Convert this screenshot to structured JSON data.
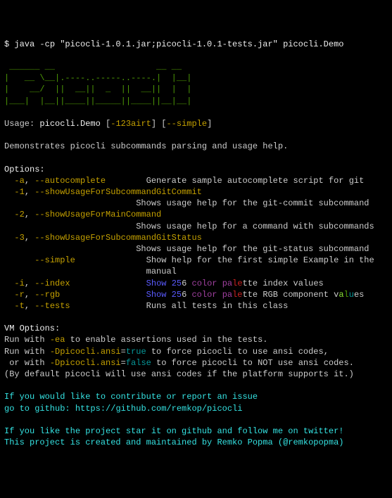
{
  "prompt": "$ ",
  "command": "java -cp \"picocli-1.0.1.jar;picocli-1.0.1-tests.jar\" picocli.Demo",
  "ascii_art": " ______ __                    __ __\n|   __ \\__|.----..-----..----.|  |__|\n|    __/  ||  __||  _  ||  __||  |  |\n|___|  |__||____||_____||____||__|__|",
  "usage_prefix": "Usage: ",
  "usage_cmd": "picocli.Demo",
  "usage_brk1": " [",
  "usage_shortopts": "-123airt",
  "usage_brk2": "] [",
  "usage_longopt": "--simple",
  "usage_brk3": "]",
  "description": "Demonstrates picocli subcommands parsing and usage help.",
  "options_header": "Options:",
  "opts": [
    {
      "pad": "  ",
      "short": "-a",
      "sep": ", ",
      "long": "--autocomplete",
      "gap": "        ",
      "desc": "Generate sample autocomplete script for git"
    },
    {
      "pad": "  ",
      "short": "-1",
      "sep": ", ",
      "long": "--showUsageForSubcommandGitCommit",
      "gap": "",
      "desc": ""
    },
    {
      "pad": "                          ",
      "short": "",
      "sep": "",
      "long": "",
      "gap": "",
      "desc": "Shows usage help for the git-commit subcommand"
    },
    {
      "pad": "  ",
      "short": "-2",
      "sep": ", ",
      "long": "--showUsageForMainCommand",
      "gap": "",
      "desc": ""
    },
    {
      "pad": "                          ",
      "short": "",
      "sep": "",
      "long": "",
      "gap": "",
      "desc": "Shows usage help for a command with subcommands"
    },
    {
      "pad": "  ",
      "short": "-3",
      "sep": ", ",
      "long": "--showUsageForSubcommandGitStatus",
      "gap": "",
      "desc": ""
    },
    {
      "pad": "                          ",
      "short": "",
      "sep": "",
      "long": "",
      "gap": "",
      "desc": "Shows usage help for the git-status subcommand"
    },
    {
      "pad": "      ",
      "short": "",
      "sep": "",
      "long": "--simple",
      "gap": "              ",
      "desc": "Show help for the first simple Example in the"
    },
    {
      "pad": "                            ",
      "short": "",
      "sep": "",
      "long": "",
      "gap": "",
      "desc": "manual"
    }
  ],
  "color_opts": {
    "i": {
      "short": "-i",
      "long": "--index",
      "w1": "Show",
      "w2": "25",
      "w3": "6",
      "w4": "color",
      "w5": "pa",
      "w6": "le",
      "w7": "tte",
      "tail": " index values"
    },
    "r": {
      "short": "-r",
      "long": "--rgb",
      "w1": "Show",
      "w2": "25",
      "w3": "6",
      "w4": "color",
      "w5": "pa",
      "w6": "le",
      "w7": "tte",
      "tail1": " RGB component v",
      "tail2": "a",
      "tail3": "l",
      "tail4": "u",
      "tail5": "es"
    },
    "t": {
      "short": "-t",
      "long": "--tests",
      "desc": "Runs all tests in this class"
    }
  },
  "vm_header": "VM Options:",
  "vm_l1_a": "Run with ",
  "vm_l1_b": "-ea",
  "vm_l1_c": " to enable assertions used in the tests.",
  "vm_l2_a": "Run with ",
  "vm_l2_b": "-Dpicocli.ansi",
  "vm_l2_c": "=",
  "vm_l2_d": "true",
  "vm_l2_e": " to force picocli to use ansi codes,",
  "vm_l3_a": " or with ",
  "vm_l3_b": "-Dpicocli.ansi",
  "vm_l3_c": "=",
  "vm_l3_d": "false",
  "vm_l3_e": " to force picocli to NOT use ansi codes.",
  "vm_l4": "(By default picocli will use ansi codes if the platform supports it.)",
  "ft1": "If you would like to contribute or report an issue",
  "ft2a": "go to github: ",
  "ft2b": "https://github.com/remkop/picocli",
  "ft3": "If you like the project star it on github and follow me on twitter!",
  "ft4": "This project is created and maintained by Remko Popma (@remkopopma)"
}
